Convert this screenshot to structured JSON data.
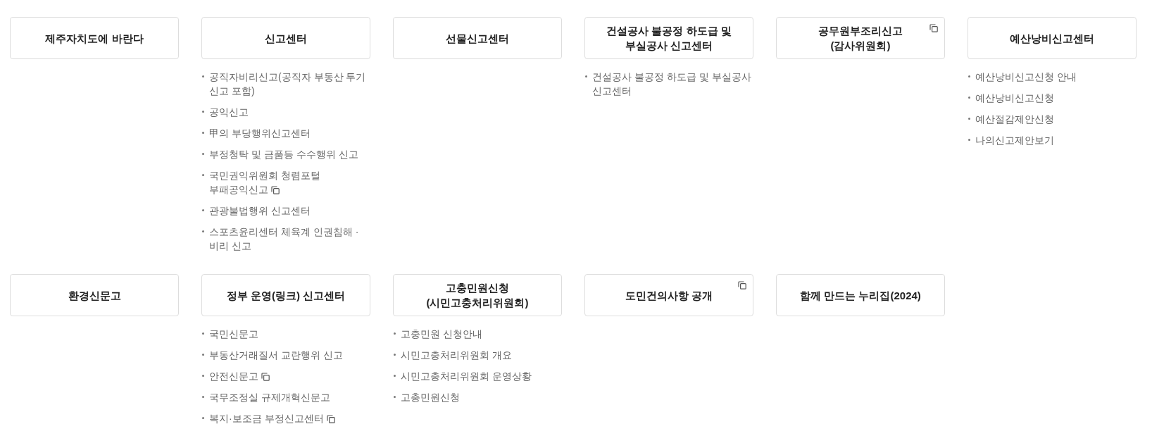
{
  "menus": [
    {
      "title": "제주자치도에 바란다",
      "opens_new_window": false
    },
    {
      "title": "신고센터",
      "opens_new_window": false,
      "links": [
        {
          "label": "공직자비리신고(공직자 부동산 투기 신고 포함)",
          "opens_new_window": false
        },
        {
          "label": "공익신고",
          "opens_new_window": false
        },
        {
          "label": "甲의 부당행위신고센터",
          "opens_new_window": false
        },
        {
          "label": "부정청탁 및 금품등 수수행위 신고",
          "opens_new_window": false
        },
        {
          "label": "국민권익위원회 청렴포털 부패공익신고",
          "opens_new_window": true
        },
        {
          "label": "관광불법행위 신고센터",
          "opens_new_window": false
        },
        {
          "label": "스포츠윤리센터 체육계 인권침해 · 비리 신고",
          "opens_new_window": false
        }
      ]
    },
    {
      "title": "선물신고센터",
      "opens_new_window": false
    },
    {
      "title": "건설공사 불공정 하도급 및 부실공사 신고센터",
      "opens_new_window": false,
      "links": [
        {
          "label": "건설공사 불공정 하도급 및 부실공사 신고센터",
          "opens_new_window": false
        }
      ]
    },
    {
      "title": "공무원부조리신고 (감사위원회)",
      "opens_new_window": true
    },
    {
      "title": "예산낭비신고센터",
      "opens_new_window": false,
      "links": [
        {
          "label": "예산낭비신고신청 안내",
          "opens_new_window": false
        },
        {
          "label": "예산낭비신고신청",
          "opens_new_window": false
        },
        {
          "label": "예산절감제안신청",
          "opens_new_window": false
        },
        {
          "label": "나의신고제안보기",
          "opens_new_window": false
        }
      ]
    },
    {
      "title": "환경신문고",
      "opens_new_window": false
    },
    {
      "title": "정부 운영(링크) 신고센터",
      "opens_new_window": false,
      "links": [
        {
          "label": "국민신문고",
          "opens_new_window": false
        },
        {
          "label": "부동산거래질서 교란행위 신고",
          "opens_new_window": false
        },
        {
          "label": "안전신문고",
          "opens_new_window": true
        },
        {
          "label": "국무조정실 규제개혁신문고",
          "opens_new_window": false
        },
        {
          "label": "복지·보조금 부정신고센터",
          "opens_new_window": true
        }
      ]
    },
    {
      "title": "고충민원신청 (시민고충처리위원회)",
      "opens_new_window": false,
      "links": [
        {
          "label": "고충민원 신청안내",
          "opens_new_window": false
        },
        {
          "label": "시민고충처리위원회 개요",
          "opens_new_window": false
        },
        {
          "label": "시민고충처리위원회 운영상황",
          "opens_new_window": false
        },
        {
          "label": "고충민원신청",
          "opens_new_window": false
        }
      ]
    },
    {
      "title": "도민건의사항 공개",
      "opens_new_window": true
    },
    {
      "title": "함께 만드는 누리집(2024)",
      "opens_new_window": false
    }
  ]
}
